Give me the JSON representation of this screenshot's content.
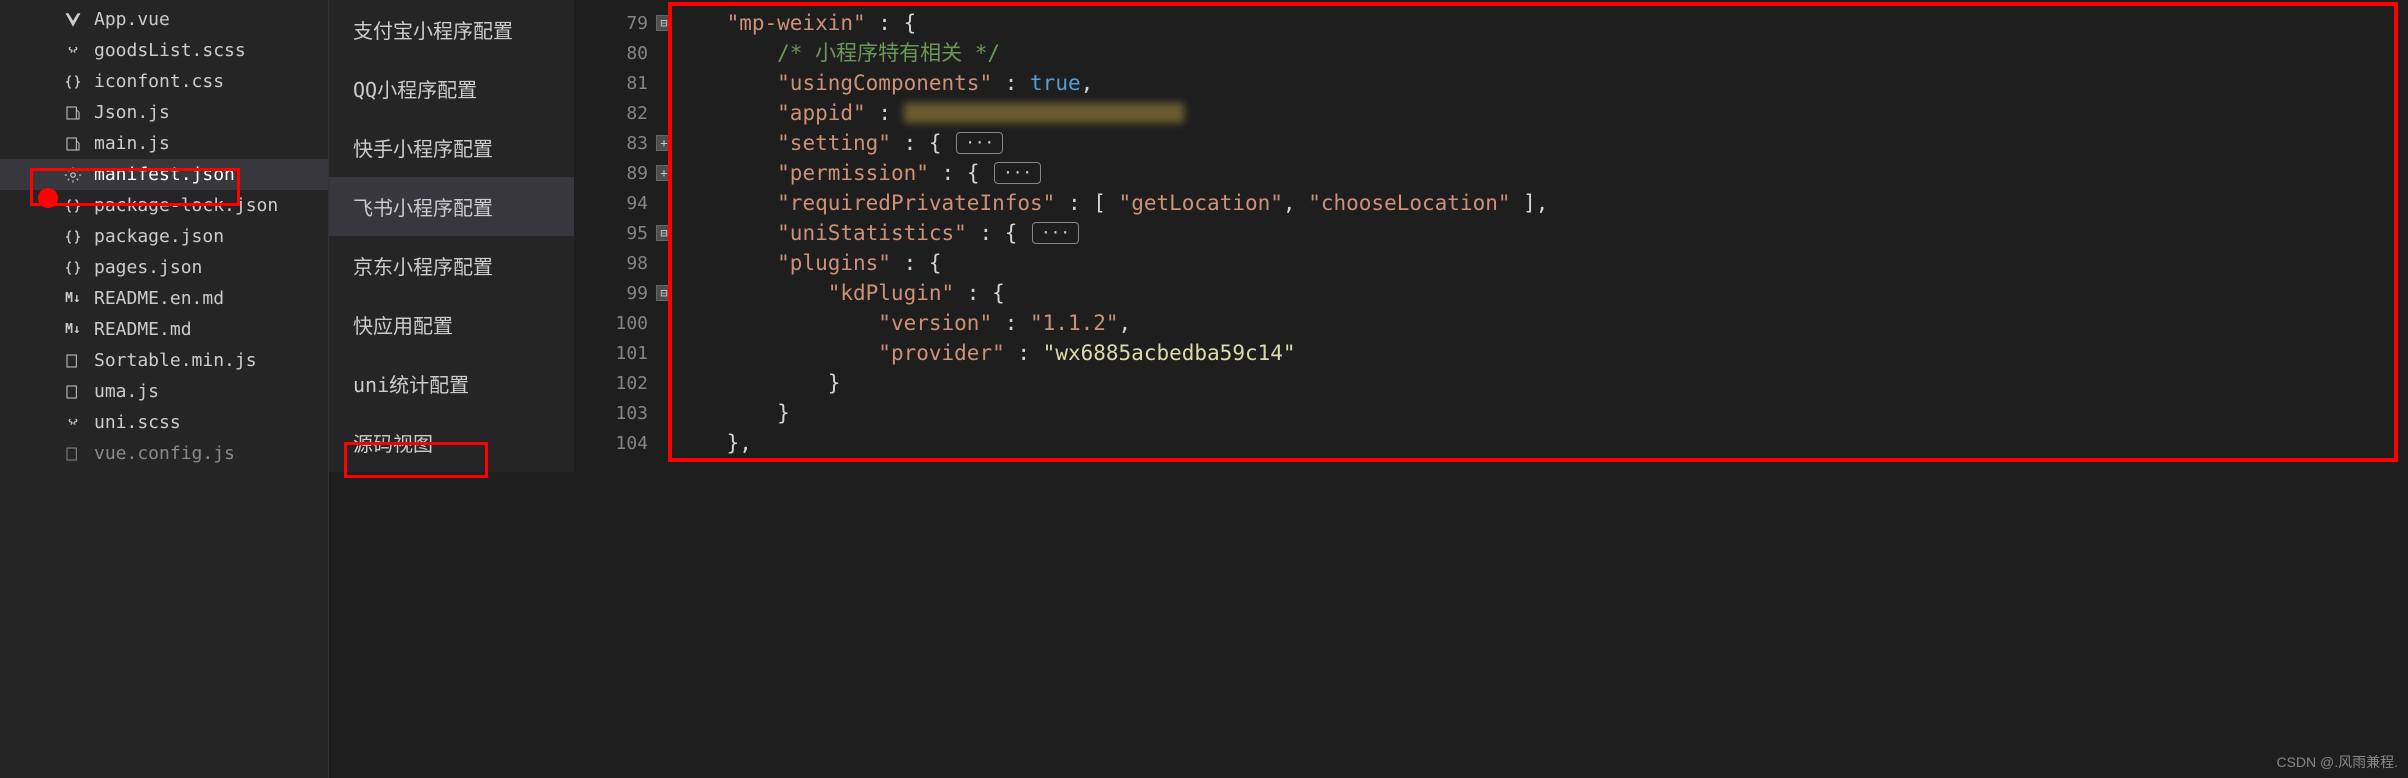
{
  "files": [
    {
      "name": "App.vue",
      "icon": "vue"
    },
    {
      "name": "goodsList.scss",
      "icon": "scss"
    },
    {
      "name": "iconfont.css",
      "icon": "css"
    },
    {
      "name": "Json.js",
      "icon": "js"
    },
    {
      "name": "main.js",
      "icon": "js"
    },
    {
      "name": "manifest.json",
      "icon": "gear",
      "active": true
    },
    {
      "name": "package-lock.json",
      "icon": "json"
    },
    {
      "name": "package.json",
      "icon": "json"
    },
    {
      "name": "pages.json",
      "icon": "json"
    },
    {
      "name": "README.en.md",
      "icon": "md"
    },
    {
      "name": "README.md",
      "icon": "md"
    },
    {
      "name": "Sortable.min.js",
      "icon": "js"
    },
    {
      "name": "uma.js",
      "icon": "js"
    },
    {
      "name": "uni.scss",
      "icon": "scss"
    },
    {
      "name": "vue.config.js",
      "icon": "js"
    }
  ],
  "configItems": [
    {
      "label": "支付宝小程序配置"
    },
    {
      "label": "QQ小程序配置"
    },
    {
      "label": "快手小程序配置"
    },
    {
      "label": "飞书小程序配置",
      "active": true
    },
    {
      "label": "京东小程序配置"
    },
    {
      "label": "快应用配置"
    },
    {
      "label": "uni统计配置"
    },
    {
      "label": "源码视图"
    }
  ],
  "lineNumbers": [
    "79",
    "80",
    "81",
    "82",
    "83",
    "89",
    "94",
    "95",
    "98",
    "99",
    "100",
    "101",
    "102",
    "103",
    "104"
  ],
  "foldMarkers": {
    "79": "open",
    "83": "plus",
    "89": "plus",
    "95": "open",
    "99": "open"
  },
  "code": {
    "l79": {
      "indent": "    ",
      "key": "\"mp-weixin\"",
      "colon": " : ",
      "open": "{"
    },
    "l80": {
      "indent": "        ",
      "comment": "/* 小程序特有相关 */"
    },
    "l81": {
      "indent": "        ",
      "key": "\"usingComponents\"",
      "colon": " : ",
      "val": "true",
      "comma": ","
    },
    "l82": {
      "indent": "        ",
      "key": "\"appid\"",
      "colon": " : "
    },
    "l83": {
      "indent": "        ",
      "key": "\"setting\"",
      "colon": " : ",
      "open": "{ ",
      "ellipsis": "···",
      "close": ""
    },
    "l89": {
      "indent": "        ",
      "key": "\"permission\"",
      "colon": " : ",
      "open": "{ ",
      "ellipsis": "···",
      "close": ""
    },
    "l94": {
      "indent": "        ",
      "key": "\"requiredPrivateInfos\"",
      "colon": " : ",
      "open": "[ ",
      "v1": "\"getLocation\"",
      "sep": ", ",
      "v2": "\"chooseLocation\"",
      "close": " ],"
    },
    "l95": {
      "indent": "        ",
      "key": "\"uniStatistics\"",
      "colon": " : ",
      "open": "{ ",
      "ellipsis": "···",
      "close": ""
    },
    "l98": {
      "indent": "        ",
      "key": "\"plugins\"",
      "colon": " : ",
      "open": "{"
    },
    "l99": {
      "indent": "            ",
      "key": "\"kdPlugin\"",
      "colon": " : ",
      "open": "{"
    },
    "l100": {
      "indent": "                ",
      "key": "\"version\"",
      "colon": " : ",
      "val": "\"1.1.2\"",
      "comma": ","
    },
    "l101": {
      "indent": "                ",
      "key": "\"provider\"",
      "colon": " : ",
      "val": "\"wx6885acbedba59c14\""
    },
    "l102": {
      "indent": "            ",
      "close": "}"
    },
    "l103": {
      "indent": "        ",
      "close": "}"
    },
    "l104": {
      "indent": "    ",
      "close": "},"
    }
  },
  "watermark": "CSDN @.风雨兼程."
}
